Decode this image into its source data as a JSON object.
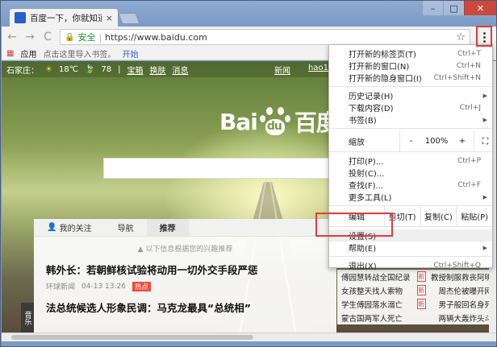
{
  "tab": {
    "title": "百度一下，你就知道",
    "close": "×"
  },
  "window_controls": {
    "minimize": "–",
    "maximize": "□",
    "close": "✕"
  },
  "toolbar": {
    "back": "←",
    "forward": "→",
    "reload": "C",
    "secure_label": "安全",
    "separator": "|",
    "url": "https://www.baidu.com",
    "star": "☆"
  },
  "bookmarks": {
    "apps": "应用",
    "hint": "点击这里导入书签。",
    "start": "开始"
  },
  "page": {
    "top_left": [
      "石家庄：",
      "☀",
      "18℃",
      "🍃",
      "78",
      "|",
      "宝箱",
      "换肤",
      "消息"
    ],
    "top_right": [
      "新闻",
      "hao123"
    ],
    "logo_left": "Bai",
    "logo_paw": "du",
    "logo_right": "百度",
    "feed_tabs": [
      "我的关注",
      "导航",
      "推荐"
    ],
    "feed_hint": "以下信息根据您的兴趣推荐",
    "news": [
      {
        "title": "韩外长：若朝鲜核试验将动用一切外交手段严惩",
        "source": "环球新闻",
        "time": "04-13 13:26",
        "badge": "热点"
      },
      {
        "title": "法总统候选人形象民调：马克龙最具“总统相”"
      }
    ],
    "side_label": "音乐",
    "hotlist": [
      {
        "left": "傅园慧转战全国纪录",
        "right": "教授制服救丧阿明"
      },
      {
        "left": "女孩整天找人索物",
        "right": "周杰伦被曝开网"
      },
      {
        "left": "学生傅园落水溺亡",
        "right": "男子般回名身死"
      },
      {
        "left": "蒙古国两军人死亡",
        "right": "两辆大轰炸头斗"
      }
    ],
    "new_badge": "新"
  },
  "menu": {
    "items_top": [
      {
        "label": "打开新的标签页(T)",
        "shortcut": "Ctrl+T"
      },
      {
        "label": "打开新的窗口(N)",
        "shortcut": "Ctrl+N"
      },
      {
        "label": "打开新的隐身窗口(I)",
        "shortcut": "Ctrl+Shift+N"
      }
    ],
    "items_mid": [
      {
        "label": "历史记录(H)",
        "shortcut": "",
        "arrow": "▶"
      },
      {
        "label": "下载内容(D)",
        "shortcut": "Ctrl+J"
      },
      {
        "label": "书签(B)",
        "shortcut": "",
        "arrow": "▶"
      }
    ],
    "zoom": {
      "label": "缩放",
      "minus": "-",
      "value": "100%",
      "plus": "+",
      "fullscreen": "⛶"
    },
    "items_tools": [
      {
        "label": "打印(P)...",
        "shortcut": "Ctrl+P"
      },
      {
        "label": "投射(C)...",
        "shortcut": ""
      },
      {
        "label": "查找(F)...",
        "shortcut": "Ctrl+F"
      },
      {
        "label": "更多工具(L)",
        "shortcut": "",
        "arrow": "▶"
      }
    ],
    "edit": {
      "label": "编辑",
      "cut": "剪切(T)",
      "copy": "复制(C)",
      "paste": "粘贴(P)"
    },
    "settings": "设置(S)",
    "help": {
      "label": "帮助(E)",
      "arrow": "▶"
    },
    "exit": {
      "label": "退出(X)",
      "shortcut": "Ctrl+Shift+Q"
    }
  }
}
